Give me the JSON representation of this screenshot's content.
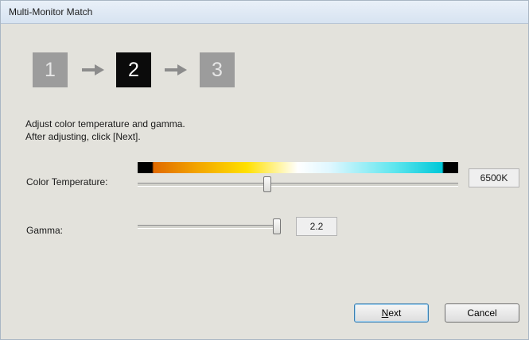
{
  "window": {
    "title": "Multi-Monitor Match"
  },
  "steps": [
    "1",
    "2",
    "3"
  ],
  "active_step": "2",
  "instructions": {
    "line1": "Adjust color temperature and gamma.",
    "line2": "After adjusting, click [Next]."
  },
  "color_temperature": {
    "label": "Color Temperature:",
    "value": "6500K"
  },
  "gamma": {
    "label": "Gamma:",
    "value": "2.2"
  },
  "buttons": {
    "next_mnemonic": "N",
    "next_rest": "ext",
    "cancel": "Cancel"
  }
}
